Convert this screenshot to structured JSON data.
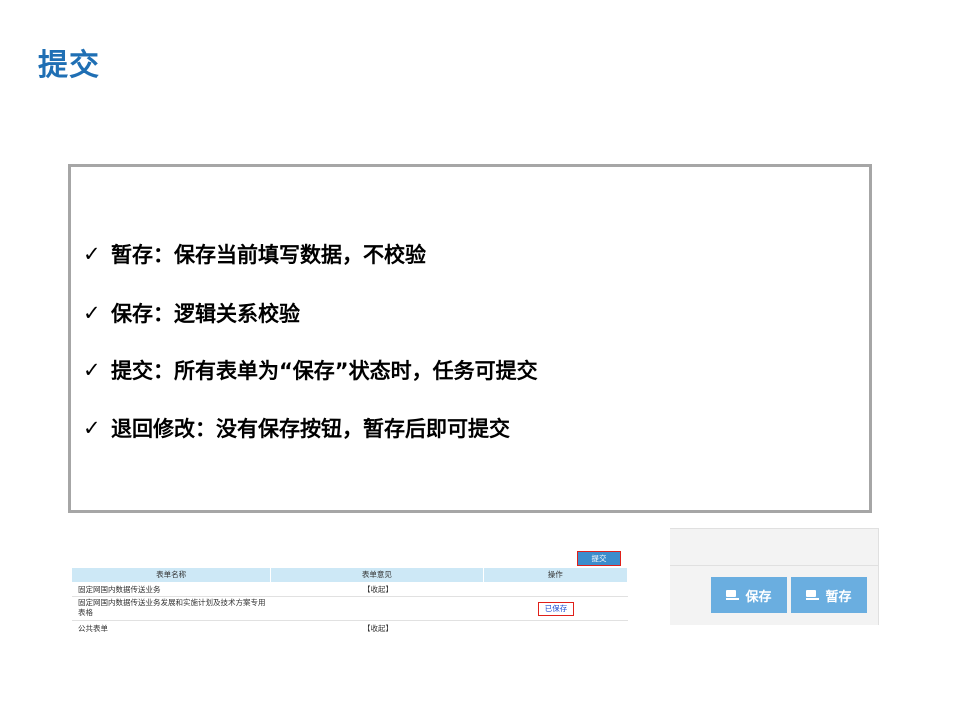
{
  "page_title": "提交",
  "bullets": [
    "暂存：保存当前填写数据，不校验",
    "保存：逻辑关系校验",
    "提交：所有表单为“保存”状态时，任务可提交",
    "退回修改：没有保存按钮，暂存后即可提交"
  ],
  "check_glyph": "✓",
  "table": {
    "submit_label": "提交",
    "headers": [
      "表单名称",
      "表单意见",
      "操作"
    ],
    "rows": [
      {
        "name": "固定网国内数据传送业务",
        "opinion": "【收起】",
        "action": ""
      },
      {
        "name": "固定网国内数据传送业务发展和实施计划及技术方案专用表格",
        "opinion": "",
        "action": "已保存"
      },
      {
        "name": "公共表单",
        "opinion": "【收起】",
        "action": ""
      }
    ]
  },
  "buttons": {
    "save_label": "保存",
    "temp_save_label": "暂存"
  },
  "colors": {
    "title": "#1f6fb4",
    "button": "#6aaee0",
    "highlight_border": "#e0201a",
    "table_header": "#cde8f6"
  }
}
